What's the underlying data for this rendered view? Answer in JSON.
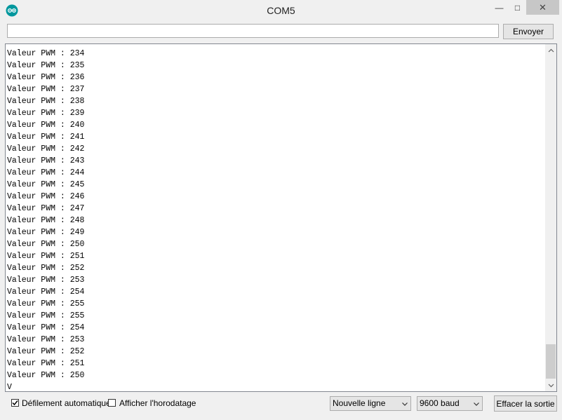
{
  "window": {
    "title": "COM5",
    "min_glyph": "—",
    "max_glyph": "□",
    "close_glyph": "✕",
    "accent": "#00979d"
  },
  "send": {
    "value": "",
    "placeholder": "",
    "button_label": "Envoyer"
  },
  "output": {
    "lines": [
      "Valeur PWM : 234",
      "Valeur PWM : 235",
      "Valeur PWM : 236",
      "Valeur PWM : 237",
      "Valeur PWM : 238",
      "Valeur PWM : 239",
      "Valeur PWM : 240",
      "Valeur PWM : 241",
      "Valeur PWM : 242",
      "Valeur PWM : 243",
      "Valeur PWM : 244",
      "Valeur PWM : 245",
      "Valeur PWM : 246",
      "Valeur PWM : 247",
      "Valeur PWM : 248",
      "Valeur PWM : 249",
      "Valeur PWM : 250",
      "Valeur PWM : 251",
      "Valeur PWM : 252",
      "Valeur PWM : 253",
      "Valeur PWM : 254",
      "Valeur PWM : 255",
      "Valeur PWM : 255",
      "Valeur PWM : 254",
      "Valeur PWM : 253",
      "Valeur PWM : 252",
      "Valeur PWM : 251",
      "Valeur PWM : 250",
      "V"
    ]
  },
  "bottom": {
    "autoscroll": {
      "label": "Défilement automatique",
      "checked": true
    },
    "timestamp": {
      "label": "Afficher l'horodatage",
      "checked": false
    },
    "line_ending": "Nouvelle ligne",
    "baud": "9600 baud",
    "clear_label": "Effacer la sortie"
  },
  "icons": {
    "app": "arduino-icon",
    "check": "check-icon",
    "dropdown": "chevron-down-icon",
    "scroll_up": "chevron-up-icon",
    "scroll_down": "chevron-down-icon"
  }
}
